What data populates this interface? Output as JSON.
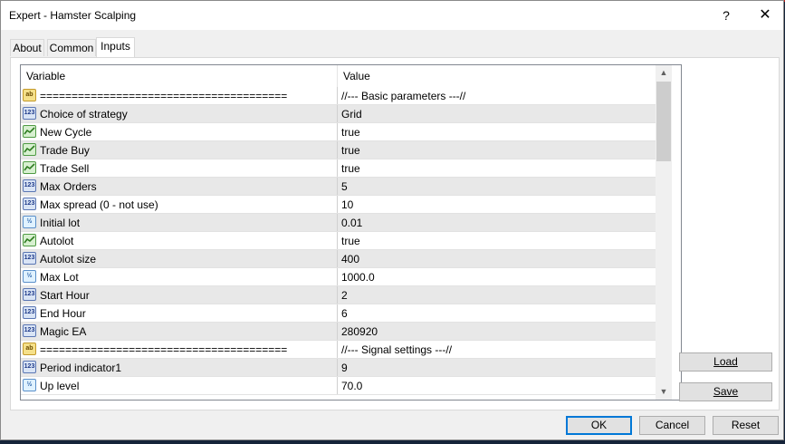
{
  "window": {
    "title": "Expert - Hamster Scalping",
    "help_label": "?",
    "close_label": "✕"
  },
  "tabs": [
    {
      "label": "About"
    },
    {
      "label": "Common"
    },
    {
      "label": "Inputs"
    }
  ],
  "table": {
    "headers": {
      "variable": "Variable",
      "value": "Value"
    },
    "rows": [
      {
        "type": "string",
        "icon": "ab",
        "name": "=======================================",
        "value": "//--- Basic parameters ---//"
      },
      {
        "type": "int",
        "icon": "123",
        "name": "Choice of strategy",
        "value": "Grid"
      },
      {
        "type": "bool",
        "icon": "",
        "name": "New Cycle",
        "value": "true"
      },
      {
        "type": "bool",
        "icon": "",
        "name": "Trade Buy",
        "value": "true"
      },
      {
        "type": "bool",
        "icon": "",
        "name": "Trade Sell",
        "value": "true"
      },
      {
        "type": "int",
        "icon": "123",
        "name": "Max Orders",
        "value": "5"
      },
      {
        "type": "int",
        "icon": "123",
        "name": "Max spread (0 - not use)",
        "value": "10"
      },
      {
        "type": "double",
        "icon": "½",
        "name": "Initial lot",
        "value": "0.01"
      },
      {
        "type": "bool",
        "icon": "",
        "name": "Autolot",
        "value": "true"
      },
      {
        "type": "int",
        "icon": "123",
        "name": "Autolot size",
        "value": "400"
      },
      {
        "type": "double",
        "icon": "½",
        "name": "Max Lot",
        "value": "1000.0"
      },
      {
        "type": "int",
        "icon": "123",
        "name": "Start Hour",
        "value": "2"
      },
      {
        "type": "int",
        "icon": "123",
        "name": "End Hour",
        "value": "6"
      },
      {
        "type": "int",
        "icon": "123",
        "name": "Magic EA",
        "value": "280920"
      },
      {
        "type": "string",
        "icon": "ab",
        "name": "=======================================",
        "value": "//--- Signal settings ---//"
      },
      {
        "type": "int",
        "icon": "123",
        "name": "Period indicator1",
        "value": "9"
      },
      {
        "type": "double",
        "icon": "½",
        "name": "Up level",
        "value": "70.0"
      }
    ]
  },
  "side_buttons": {
    "load": "Load",
    "save": "Save"
  },
  "footer": {
    "ok": "OK",
    "cancel": "Cancel",
    "reset": "Reset"
  }
}
